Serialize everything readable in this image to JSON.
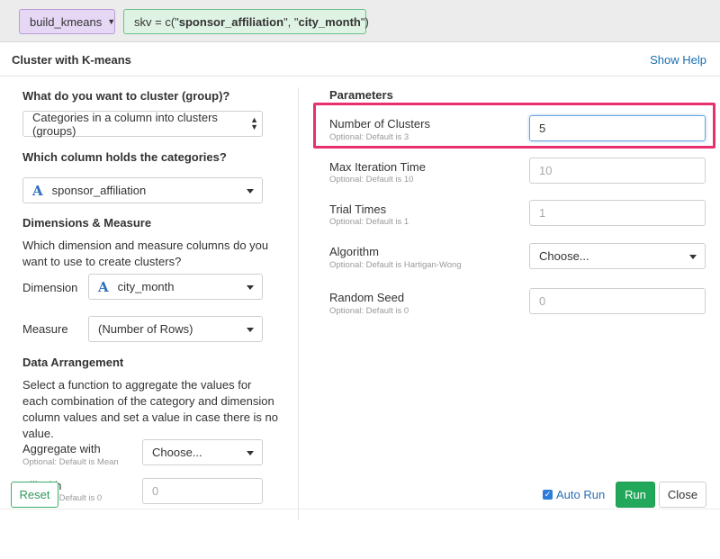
{
  "topbar": {
    "command_label": "build_kmeans",
    "args_prefix": "skv = c(\"",
    "arg1": "sponsor_affiliation",
    "args_mid": "\", \"",
    "arg2": "city_month",
    "args_suffix": "\")"
  },
  "dialog": {
    "title": "Cluster with K-means",
    "help_link": "Show Help"
  },
  "left": {
    "q_cluster": "What do you want to cluster (group)?",
    "cluster_select": "Categories in a column into clusters (groups)",
    "q_column": "Which column holds the categories?",
    "column_select": "sponsor_affiliation",
    "dim_measure_heading": "Dimensions & Measure",
    "dim_measure_desc_1": "Which dimension and measure columns do you",
    "dim_measure_desc_2": "want to use to create clusters?",
    "dimension_label": "Dimension",
    "dimension_select": "city_month",
    "measure_label": "Measure",
    "measure_select": "(Number of Rows)",
    "arrangement_heading": "Data Arrangement",
    "arrangement_desc_1": "Select a function to aggregate the values for",
    "arrangement_desc_2": "each combination of the category and dimension",
    "arrangement_desc_3": "column values and set a value in case there is no",
    "arrangement_desc_4": "value.",
    "aggregate_label": "Aggregate with",
    "aggregate_hint": "Optional: Default is Mean",
    "aggregate_select": "Choose...",
    "fill_label": "Fill with",
    "fill_hint": "Optional: Default is 0",
    "fill_placeholder": "0"
  },
  "right": {
    "heading": "Parameters",
    "num_clusters_label": "Number of Clusters",
    "num_clusters_hint": "Optional: Default is 3",
    "num_clusters_value": "5",
    "max_iter_label": "Max Iteration Time",
    "max_iter_hint": "Optional: Default is 10",
    "max_iter_placeholder": "10",
    "trial_label": "Trial Times",
    "trial_hint": "Optional: Default is 1",
    "trial_placeholder": "1",
    "algorithm_label": "Algorithm",
    "algorithm_hint": "Optional: Default is Hartigan-Wong",
    "algorithm_select": "Choose...",
    "seed_label": "Random Seed",
    "seed_hint": "Optional: Default is 0",
    "seed_placeholder": "0"
  },
  "footer": {
    "reset_label": "Reset",
    "auto_run_label": "Auto Run",
    "auto_run_checked": true,
    "run_label": "Run",
    "close_label": "Close"
  },
  "colors": {
    "command_chip_bg": "#e6d8f5",
    "arg_chip_bg": "#dff3e4",
    "run_button": "#22a85a",
    "link": "#1a6fb0",
    "highlight_box": "#e8306e"
  }
}
